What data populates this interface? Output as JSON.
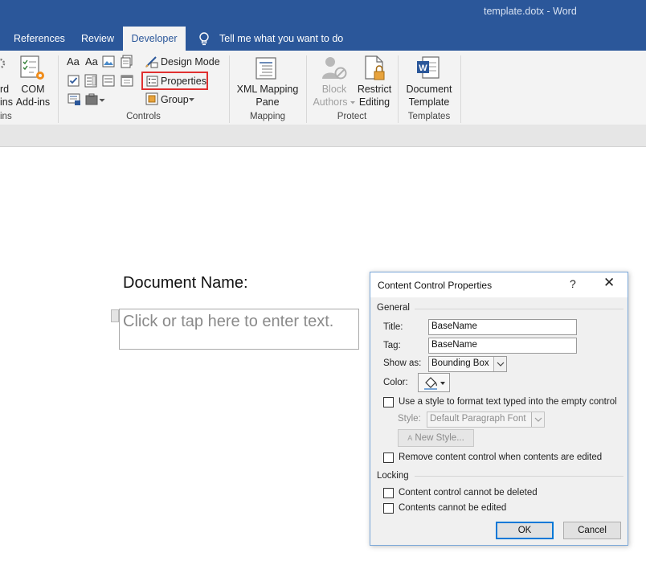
{
  "window": {
    "title": "template.dotx - Word"
  },
  "tabs": [
    {
      "label": "References"
    },
    {
      "label": "Review"
    },
    {
      "label": "Developer",
      "active": true
    },
    {
      "label": "Tell me what you want to do"
    }
  ],
  "ribbon": {
    "partial_left": {
      "line1": "rd",
      "line2": "ins",
      "group": "ins"
    },
    "com_addins": {
      "line1": "COM",
      "line2": "Add-ins"
    },
    "controls": {
      "design_mode": "Design Mode",
      "properties": "Properties",
      "group": "Group",
      "group_label": "Controls",
      "icons": [
        "aa-rich-text-icon",
        "aa-plain-text-icon",
        "picture-control-icon",
        "building-block-icon",
        "checkbox-control-icon",
        "combo-box-icon",
        "dropdown-list-icon",
        "date-picker-icon",
        "repeating-section-icon",
        "legacy-tools-icon"
      ]
    },
    "mapping": {
      "line1": "XML Mapping",
      "line2": "Pane",
      "group_label": "Mapping"
    },
    "protect": {
      "block_authors_line1": "Block",
      "block_authors_line2": "Authors",
      "restrict_line1": "Restrict",
      "restrict_line2": "Editing",
      "group_label": "Protect"
    },
    "templates": {
      "line1": "Document",
      "line2": "Template",
      "group_label": "Templates"
    },
    "highlight_color": "#e03030"
  },
  "document": {
    "label": "Document Name:",
    "placeholder": "Click or tap here to enter text."
  },
  "dialog": {
    "title": "Content Control Properties",
    "help": "?",
    "close": "✕",
    "general_label": "General",
    "title_label": "Title:",
    "title_value": "BaseName",
    "tag_label": "Tag:",
    "tag_value": "BaseName",
    "show_as_label": "Show as:",
    "show_as_value": "Bounding Box",
    "color_label": "Color:",
    "use_style_label": "Use a style to format text typed into the empty control",
    "style_label": "Style:",
    "style_value": "Default Paragraph Font",
    "new_style_label": "New Style...",
    "remove_label": "Remove content control when contents are edited",
    "locking_label": "Locking",
    "cannot_delete_label": "Content control cannot be deleted",
    "cannot_edit_label": "Contents cannot be edited",
    "ok_label": "OK",
    "cancel_label": "Cancel"
  }
}
